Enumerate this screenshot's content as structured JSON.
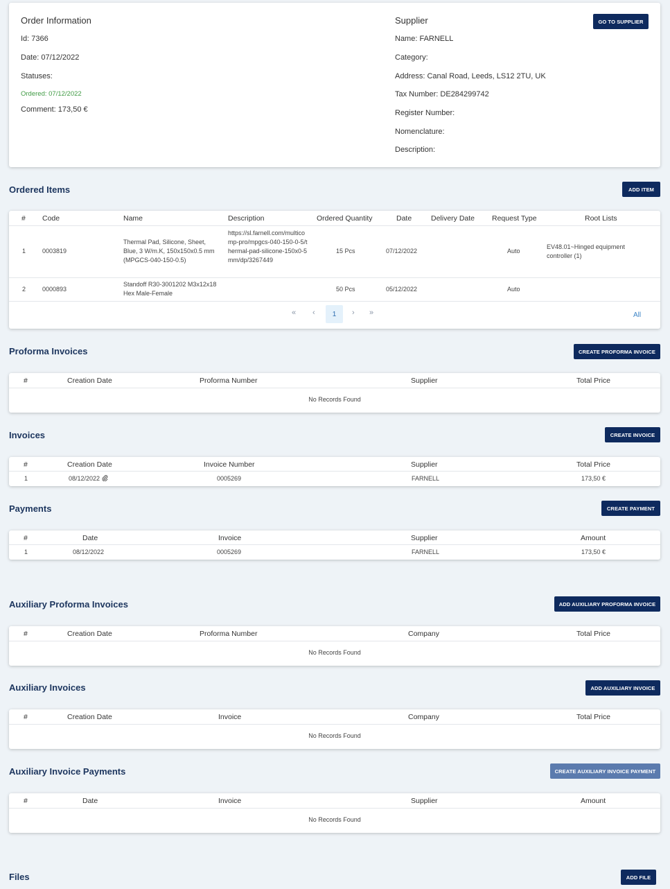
{
  "order_info": {
    "title": "Order Information",
    "id": "Id: 7366",
    "date": "Date: 07/12/2022",
    "statuses_label": "Statuses:",
    "status": "Ordered: 07/12/2022",
    "comment": "Comment: 173,50 €"
  },
  "supplier": {
    "title": "Supplier",
    "go_button": "GO TO SUPPLIER",
    "name": "Name: FARNELL",
    "category": "Category:",
    "address": "Address: Canal Road, Leeds, LS12 2TU, UK",
    "tax": "Tax Number: DE284299742",
    "register": "Register Number:",
    "nomenclature": "Nomenclature:",
    "description": "Description:"
  },
  "ordered_items": {
    "title": "Ordered Items",
    "add_button": "ADD ITEM",
    "headers": [
      "#",
      "Code",
      "Name",
      "Description",
      "Ordered Quantity",
      "Date",
      "Delivery Date",
      "Request Type",
      "Root Lists"
    ],
    "rows": [
      {
        "num": "1",
        "code": "0003819",
        "name": "Thermal Pad, Silicone, Sheet, Blue, 3 W/m.K, 150x150x0.5 mm (MPGCS-040-150-0.5)",
        "description": "https://sl.farnell.com/multicomp-pro/mpgcs-040-150-0-5/thermal-pad-silicone-150x0-5mm/dp/3267449",
        "qty": "15 Pcs",
        "date": "07/12/2022",
        "delivery": "",
        "request_type": "Auto",
        "root_lists": "EV48.01~Hinged equipment controller (1)"
      },
      {
        "num": "2",
        "code": "0000893",
        "name": "Standoff R30-3001202 M3x12x18 Hex Male-Female",
        "description": "",
        "qty": "50 Pcs",
        "date": "05/12/2022",
        "delivery": "",
        "request_type": "Auto",
        "root_lists": ""
      }
    ],
    "pagination": {
      "first": "«",
      "prev": "‹",
      "current": "1",
      "next": "›",
      "last": "»",
      "all": "All"
    }
  },
  "proforma": {
    "title": "Proforma Invoices",
    "button": "CREATE PROFORMA INVOICE",
    "headers": [
      "#",
      "Creation Date",
      "Proforma Number",
      "Supplier",
      "Total Price"
    ],
    "empty": "No Records Found"
  },
  "invoices": {
    "title": "Invoices",
    "button": "CREATE INVOICE",
    "headers": [
      "#",
      "Creation Date",
      "Invoice Number",
      "Supplier",
      "Total Price"
    ],
    "rows": [
      {
        "num": "1",
        "date": "08/12/2022",
        "number": "0005269",
        "supplier": "FARNELL",
        "total": "173,50 €"
      }
    ]
  },
  "payments": {
    "title": "Payments",
    "button": "CREATE PAYMENT",
    "headers": [
      "#",
      "Date",
      "Invoice",
      "Supplier",
      "Amount"
    ],
    "rows": [
      {
        "num": "1",
        "date": "08/12/2022",
        "invoice": "0005269",
        "supplier": "FARNELL",
        "amount": "173,50 €"
      }
    ]
  },
  "aux_proforma": {
    "title": "Auxiliary Proforma Invoices",
    "button": "ADD AUXILIARY PROFORMA INVOICE",
    "headers": [
      "#",
      "Creation Date",
      "Proforma Number",
      "Company",
      "Total Price"
    ],
    "empty": "No Records Found"
  },
  "aux_invoices": {
    "title": "Auxiliary Invoices",
    "button": "ADD AUXILIARY INVOICE",
    "headers": [
      "#",
      "Creation Date",
      "Invoice",
      "Company",
      "Total Price"
    ],
    "empty": "No Records Found"
  },
  "aux_payments": {
    "title": "Auxiliary Invoice Payments",
    "button": "CREATE AUXILIARY INVOICE PAYMENT",
    "headers": [
      "#",
      "Date",
      "Invoice",
      "Supplier",
      "Amount"
    ],
    "empty": "No Records Found"
  },
  "files": {
    "title": "Files",
    "button": "ADD FILE"
  },
  "colors": {
    "primary_button": "#0e2a5e",
    "disabled_button": "#5b7bae",
    "section_title": "#1c355e",
    "status_green": "#3f9a43",
    "link": "#3d84c6",
    "background": "#eef3f7"
  },
  "icons": {
    "attachment": "paperclip-icon"
  }
}
